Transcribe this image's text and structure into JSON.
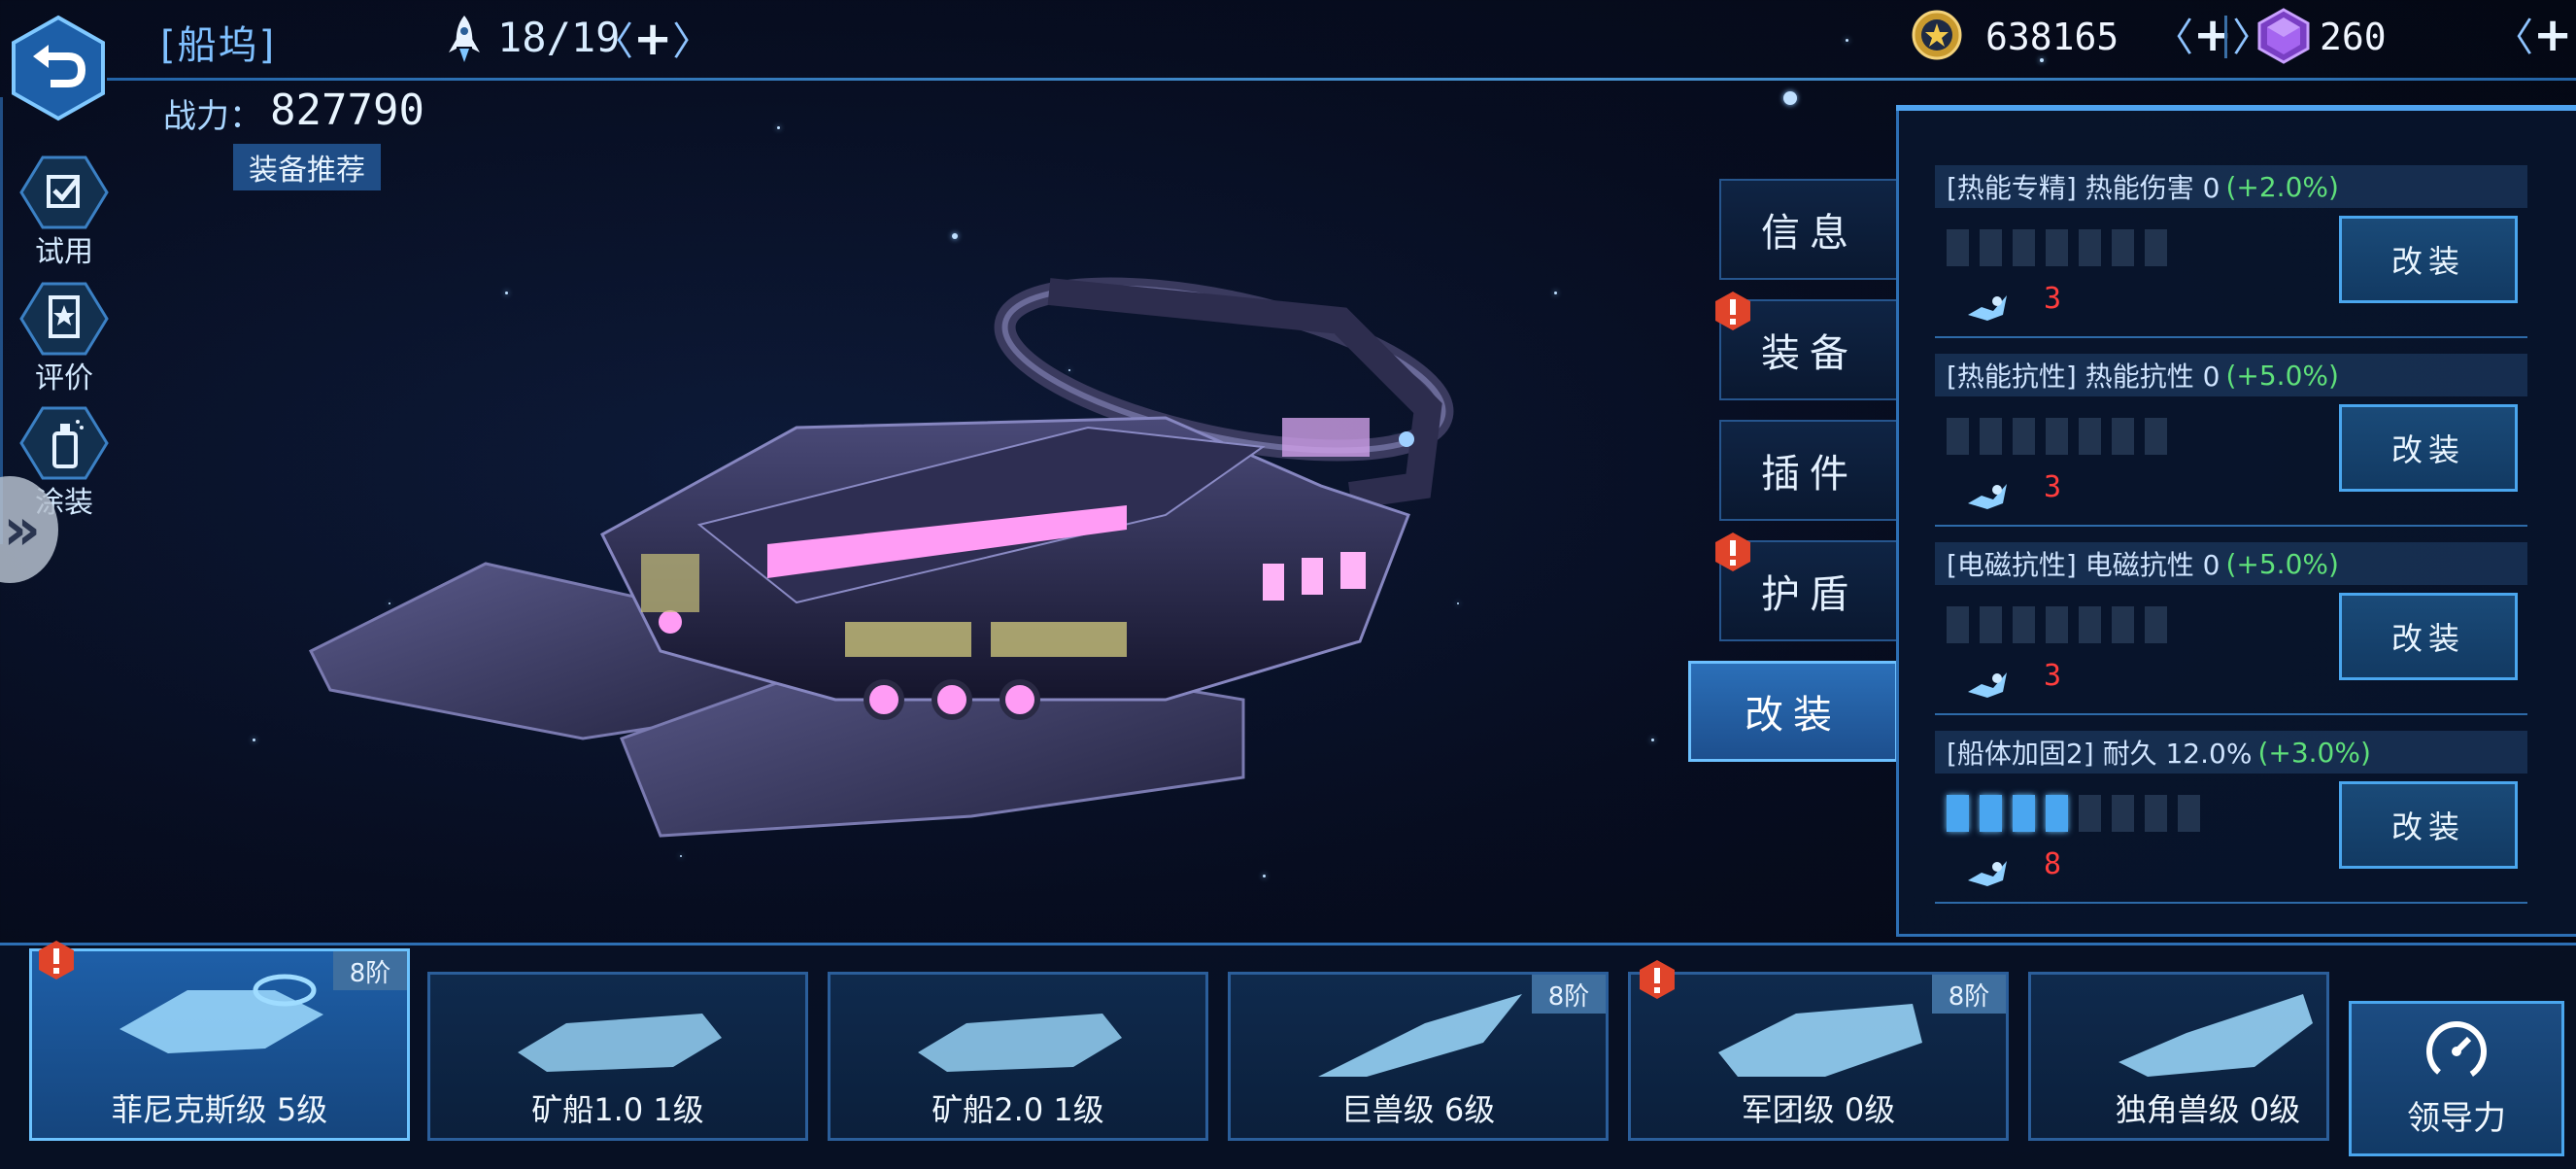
{
  "header": {
    "dock_title": "[船坞]",
    "ship_count": "18/19",
    "power_label": "战力：",
    "power_value": "827790",
    "equip_recommend": "装备推荐",
    "coins": "638165",
    "gems": "260",
    "plus_symbol": "+",
    "bracket_left": "〈",
    "bracket_right": "〉"
  },
  "side_menu": [
    {
      "label": "试用",
      "icon": "checkbox-icon"
    },
    {
      "label": "评价",
      "icon": "star-card-icon"
    },
    {
      "label": "涂装",
      "icon": "spray-can-icon"
    }
  ],
  "tabs": [
    {
      "label": "信息",
      "alert": false
    },
    {
      "label": "装备",
      "alert": true
    },
    {
      "label": "插件",
      "alert": false
    },
    {
      "label": "护盾",
      "alert": true
    },
    {
      "label": "改装",
      "alert": false,
      "active": true
    }
  ],
  "mods": [
    {
      "tag": "[热能专精]",
      "stat": "热能伤害 0",
      "bonus": "(+2.0%)",
      "level": 0,
      "max_level": 7,
      "parts": "3",
      "button": "改装"
    },
    {
      "tag": "[热能抗性]",
      "stat": "热能抗性 0",
      "bonus": "(+5.0%)",
      "level": 0,
      "max_level": 7,
      "parts": "3",
      "button": "改装"
    },
    {
      "tag": "[电磁抗性]",
      "stat": "电磁抗性 0",
      "bonus": "(+5.0%)",
      "level": 0,
      "max_level": 7,
      "parts": "3",
      "button": "改装"
    },
    {
      "tag": "[船体加固2]",
      "stat": "耐久 12.0%",
      "bonus": "(+3.0%)",
      "level": 4,
      "max_level": 8,
      "parts": "8",
      "button": "改装"
    }
  ],
  "ships": [
    {
      "name": "菲尼克斯级 5级",
      "tier": "8阶",
      "alert": true,
      "selected": true
    },
    {
      "name": "矿船1.0 1级",
      "tier": "",
      "alert": false
    },
    {
      "name": "矿船2.0 1级",
      "tier": "",
      "alert": false
    },
    {
      "name": "巨兽级 6级",
      "tier": "8阶",
      "alert": false
    },
    {
      "name": "军团级 0级",
      "tier": "8阶",
      "alert": true
    },
    {
      "name": "独角兽级 0级",
      "tier": "",
      "alert": false
    }
  ],
  "leader_button": "领导力",
  "colors": {
    "accent": "#4aa6f0",
    "bonus_green": "#5fe07a",
    "alert_red": "#e0442a",
    "parts_red": "#ff3d3d"
  }
}
